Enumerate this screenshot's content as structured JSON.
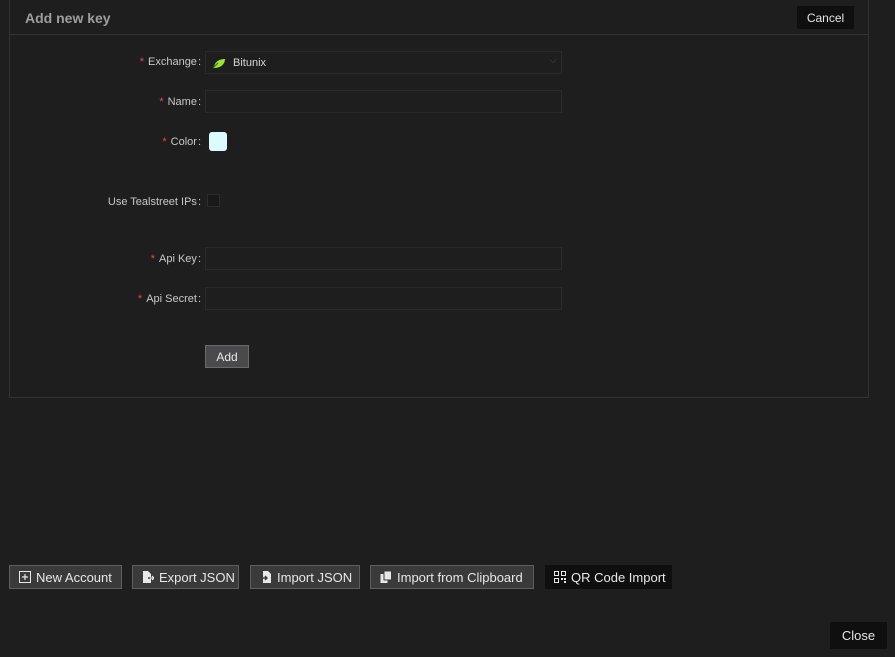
{
  "header": {
    "title": "Add new key",
    "cancel_label": "Cancel"
  },
  "form": {
    "exchange": {
      "label": "Exchange",
      "value": "Bitunix"
    },
    "name": {
      "label": "Name",
      "value": ""
    },
    "color": {
      "label": "Color",
      "value": "#dcfbff"
    },
    "tealstreet_ips": {
      "label": "Use Tealstreet IPs",
      "checked": false
    },
    "api_key": {
      "label": "Api Key",
      "value": ""
    },
    "api_secret": {
      "label": "Api Secret",
      "value": ""
    },
    "add_label": "Add"
  },
  "toolbar": {
    "new_account": "New Account",
    "export_json": "Export JSON",
    "import_json": "Import JSON",
    "import_clipboard": "Import from Clipboard",
    "qr_import": "QR Code Import"
  },
  "footer": {
    "close_label": "Close"
  },
  "colors": {
    "background": "#1f1e1f",
    "required_mark": "#e34a4a",
    "bitunix_logo": "#9be23a"
  }
}
